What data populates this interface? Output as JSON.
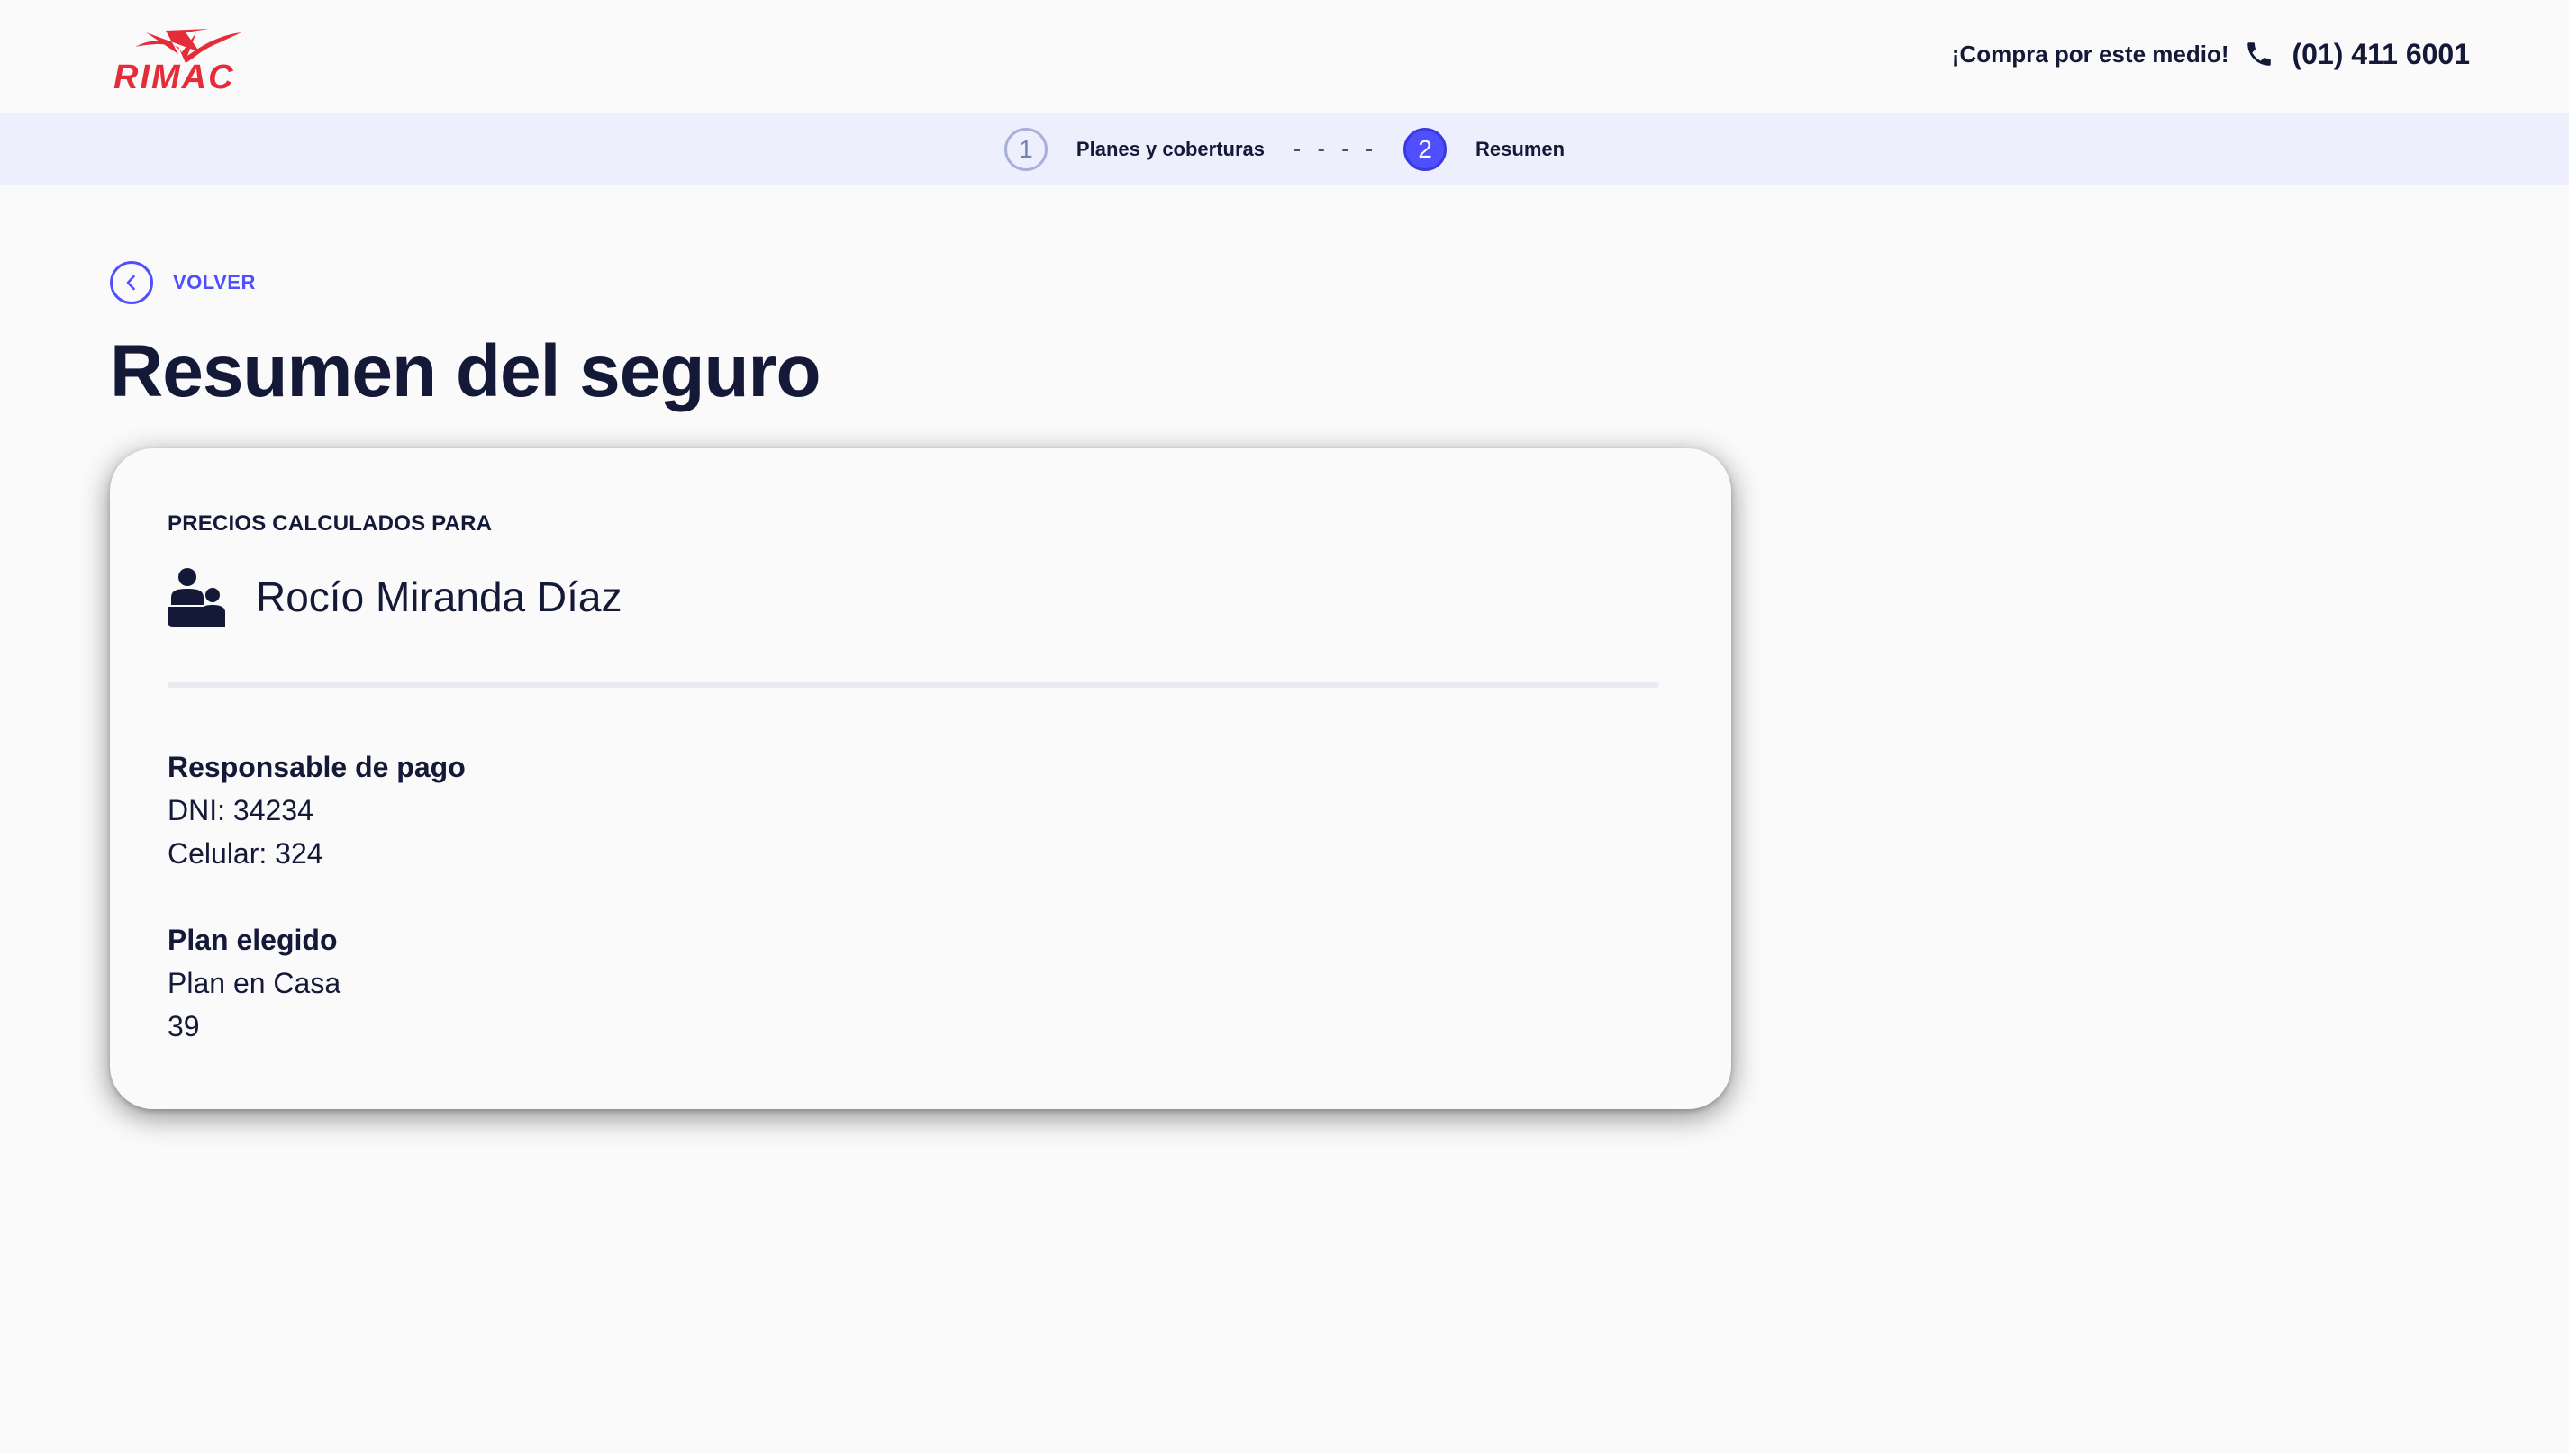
{
  "header": {
    "logo_text": "RIMAC",
    "contact_label": "¡Compra por este medio!",
    "phone_icon": "phone-icon",
    "phone_number": "(01) 411 6001"
  },
  "stepper": {
    "steps": [
      {
        "number": "1",
        "label": "Planes y coberturas",
        "active": false
      },
      {
        "number": "2",
        "label": "Resumen",
        "active": true
      }
    ],
    "separator": "----"
  },
  "back": {
    "icon": "chevron-left-icon",
    "label": "VOLVER"
  },
  "page": {
    "title": "Resumen del seguro"
  },
  "card": {
    "caption": "PRECIOS CALCULADOS PARA",
    "person_icon": "family-icon",
    "person_name": "Rocío Miranda Díaz",
    "payer": {
      "title": "Responsable de pago",
      "dni": "DNI: 34234",
      "phone": "Celular: 324"
    },
    "plan": {
      "title": "Plan elegido",
      "name": "Plan en Casa",
      "price": "39"
    }
  },
  "colors": {
    "brand_red": "#e52d3a",
    "accent": "#4f4fff",
    "text": "#141938",
    "stepper_bg": "#edeffc"
  }
}
